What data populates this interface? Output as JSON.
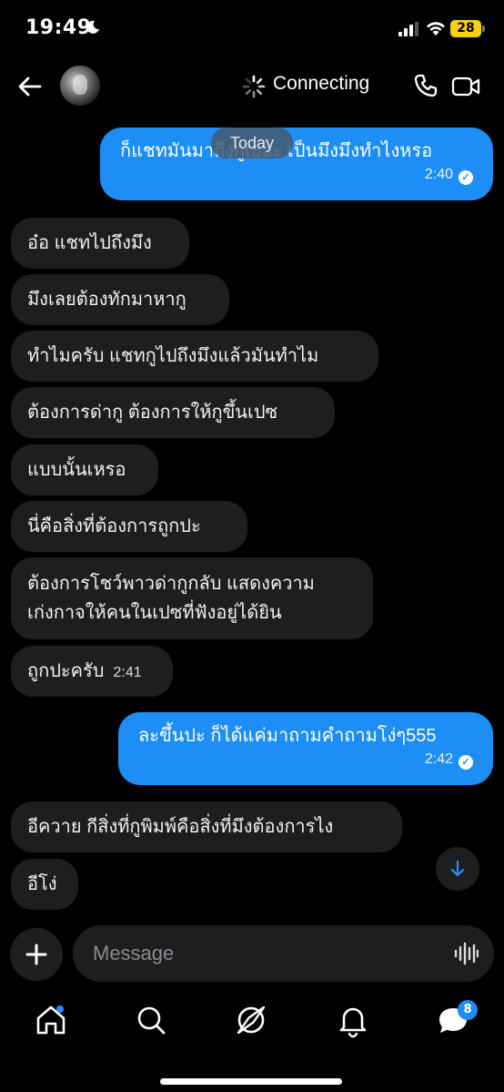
{
  "status_bar": {
    "time": "19:49",
    "battery": "28"
  },
  "header": {
    "status": "Connecting"
  },
  "date_separator": "Today",
  "messages": [
    {
      "dir": "out",
      "text": "ก็แชทมันมาถึงกูเยอะ เป็นมึงมึงทำไงหรอ",
      "time": "2:40"
    },
    {
      "dir": "in",
      "text": "อ๋อ แชทไปถึงมึง"
    },
    {
      "dir": "in",
      "text": "มึงเลยต้องทักมาหากู"
    },
    {
      "dir": "in",
      "text": "ทำไมครับ แชทกูไปถึงมึงแล้วมันทำไม"
    },
    {
      "dir": "in",
      "text": "ต้องการด่ากู ต้องการให้กูขึ้นเปซ"
    },
    {
      "dir": "in",
      "text": "แบบนั้นเหรอ"
    },
    {
      "dir": "in",
      "text": "นี่คือสิ่งที่ต้องการถูกปะ"
    },
    {
      "dir": "in",
      "text_line1": "ต้องการโชว์พาวด่ากูกลับ แสดงความ",
      "text_line2": "เก่งกาจให้คนในเปซที่ฟังอยู่ได้ยิน"
    },
    {
      "dir": "in",
      "text": "ถูกปะครับ",
      "time": "2:41"
    },
    {
      "dir": "out",
      "text": "ละขึ้นปะ ก็ได้แค่มาถามคำถามโง่ๆ555",
      "time": "2:42"
    },
    {
      "dir": "in",
      "text": "อีควาย กีสิ่งที่กูพิมพ์คือสิ่งที่มึงต้องการไง"
    },
    {
      "dir": "in",
      "text": "อีโง่"
    }
  ],
  "composer": {
    "placeholder": "Message"
  },
  "nav": {
    "messages_badge": "8"
  },
  "colors": {
    "outgoing": "#1d8ef5",
    "incoming": "#1e1e21",
    "battery": "#f5d10f"
  },
  "icons": [
    "back-arrow-icon",
    "spinner-icon",
    "phone-icon",
    "video-icon",
    "plus-icon",
    "waveform-icon",
    "home-icon",
    "search-icon",
    "compass-icon",
    "bell-icon",
    "chat-bubble-icon",
    "arrow-down-icon"
  ]
}
